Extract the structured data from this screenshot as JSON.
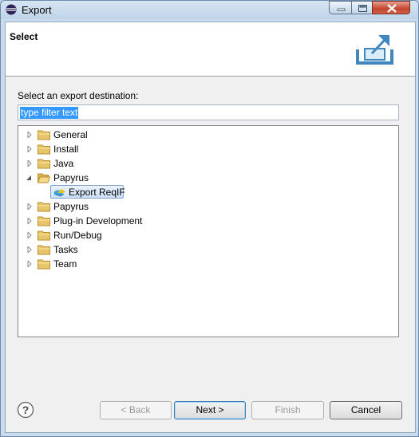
{
  "window": {
    "title": "Export"
  },
  "header": {
    "title": "Select"
  },
  "destination_label": "Select an export destination:",
  "filter": {
    "value": "type filter text"
  },
  "tree": {
    "items": [
      {
        "label": "General",
        "expanded": false
      },
      {
        "label": "Install",
        "expanded": false
      },
      {
        "label": "Java",
        "expanded": false
      },
      {
        "label": "Papyrus",
        "expanded": true,
        "children": [
          {
            "label": "Export ReqIF",
            "selected": true
          }
        ]
      },
      {
        "label": "Papyrus",
        "expanded": false
      },
      {
        "label": "Plug-in Development",
        "expanded": false
      },
      {
        "label": "Run/Debug",
        "expanded": false
      },
      {
        "label": "Tasks",
        "expanded": false
      },
      {
        "label": "Team",
        "expanded": false
      }
    ]
  },
  "buttons": {
    "back": "< Back",
    "next": "Next >",
    "finish": "Finish",
    "cancel": "Cancel"
  },
  "colors": {
    "selection": "#3399ff",
    "folder": "#e8c56a",
    "accent": "#3c7fb1"
  }
}
